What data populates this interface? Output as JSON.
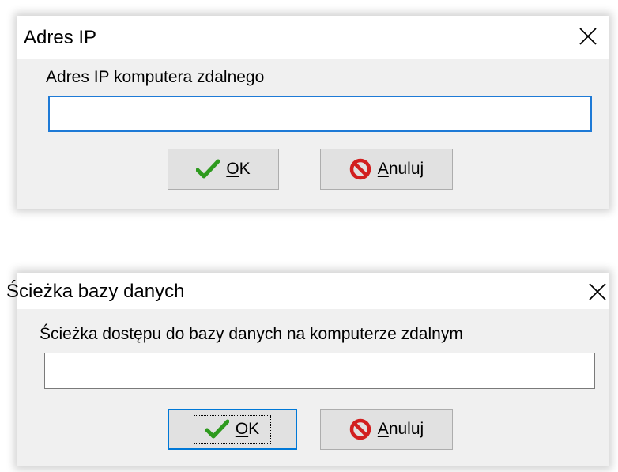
{
  "dialog_ip": {
    "title": "Adres IP",
    "label": "Adres IP komputera zdalnego",
    "input_value": "",
    "ok_mnemonic": "O",
    "ok_rest": "K",
    "cancel_mnemonic": "A",
    "cancel_rest": "nuluj"
  },
  "dialog_path": {
    "title": "Ścieżka bazy danych",
    "label": "Ścieżka dostępu do bazy danych na komputerze zdalnym",
    "input_value": "",
    "ok_mnemonic": "O",
    "ok_rest": "K",
    "cancel_mnemonic": "A",
    "cancel_rest": "nuluj"
  },
  "icons": {
    "ok": "checkmark-icon",
    "cancel": "no-entry-icon",
    "close": "close-icon"
  },
  "colors": {
    "check_green": "#2e9a1e",
    "cancel_red": "#d21f1f",
    "focus_blue": "#1e7ad6"
  }
}
